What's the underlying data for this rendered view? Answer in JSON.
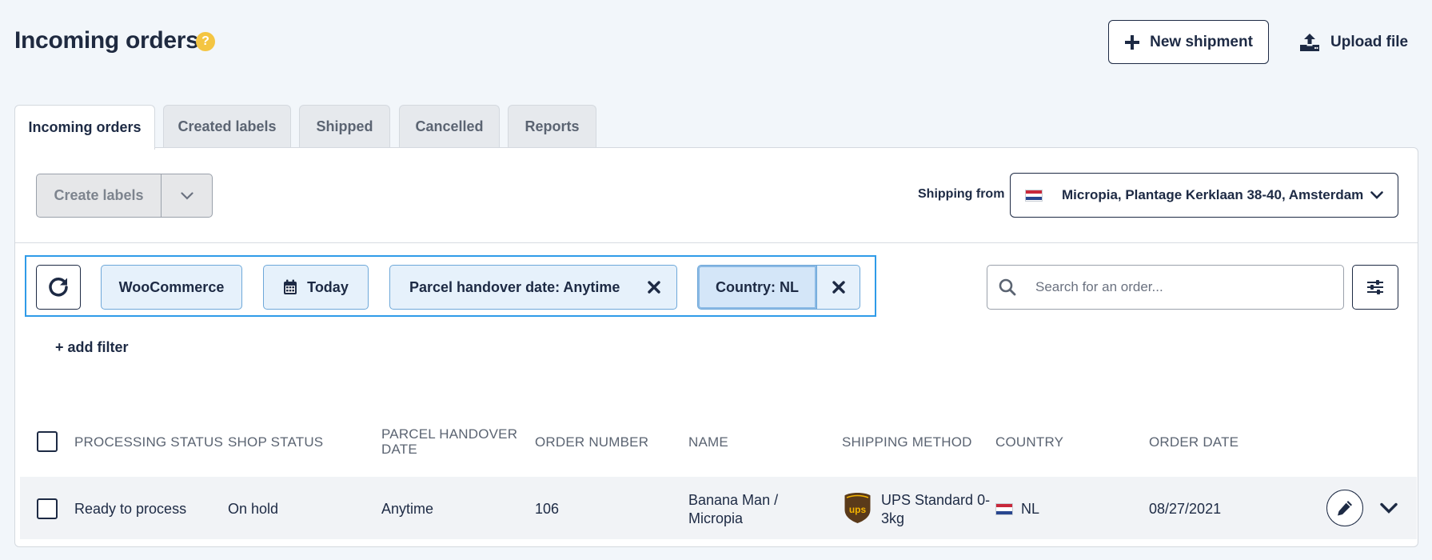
{
  "header": {
    "title": "Incoming orders",
    "help_glyph": "?",
    "new_shipment_label": "New shipment",
    "upload_file_label": "Upload file"
  },
  "tabs": [
    {
      "label": "Incoming orders",
      "active": true
    },
    {
      "label": "Created labels",
      "active": false
    },
    {
      "label": "Shipped",
      "active": false
    },
    {
      "label": "Cancelled",
      "active": false
    },
    {
      "label": "Reports",
      "active": false
    }
  ],
  "toolbar": {
    "create_labels_label": "Create labels",
    "shipping_from_label": "Shipping from",
    "shipping_from_value": "Micropia, Plantage Kerklaan 38-40, Amsterdam"
  },
  "filters": {
    "chips": [
      {
        "label": "WooCommerce",
        "removable": false
      },
      {
        "label": "Today",
        "icon": "calendar-icon",
        "removable": false
      },
      {
        "label": "Parcel handover date: Anytime",
        "removable": true
      },
      {
        "label": "Country: NL",
        "removable": true,
        "highlighted": true
      }
    ],
    "add_filter_label": "+ add filter",
    "search_placeholder": "Search for an order..."
  },
  "table": {
    "columns": [
      "PROCESSING STATUS",
      "SHOP STATUS",
      "PARCEL HANDOVER DATE",
      "ORDER NUMBER",
      "NAME",
      "SHIPPING METHOD",
      "COUNTRY",
      "ORDER DATE"
    ],
    "column_lines": {
      "parcel_handover_date": [
        "PARCEL HANDOVER",
        "DATE"
      ]
    },
    "rows": [
      {
        "processing_status": "Ready to process",
        "shop_status": "On hold",
        "parcel_handover_date": "Anytime",
        "order_number": "106",
        "name": "Banana Man / Micropia",
        "name_lines": [
          "Banana Man /",
          "Micropia"
        ],
        "shipping_method": "UPS Standard 0-3kg",
        "shipping_method_lines": [
          "UPS Standard 0-",
          "3kg"
        ],
        "carrier_logo_text": "ups",
        "country": "NL",
        "order_date": "08/27/2021"
      }
    ]
  },
  "colors": {
    "navy": "#1d2a44",
    "filter_outline": "#2f9be8",
    "chip_bg": "#e6f1fb",
    "help_yellow": "#f4c542",
    "ups_brown": "#5a3a1a",
    "ups_gold": "#f4b400"
  },
  "icons": [
    "help-icon",
    "plus-icon",
    "upload-icon",
    "chevron-down-icon",
    "netherlands-flag-icon",
    "refresh-icon",
    "calendar-icon",
    "close-icon",
    "search-icon",
    "sliders-icon",
    "ups-logo-icon",
    "pencil-icon"
  ]
}
